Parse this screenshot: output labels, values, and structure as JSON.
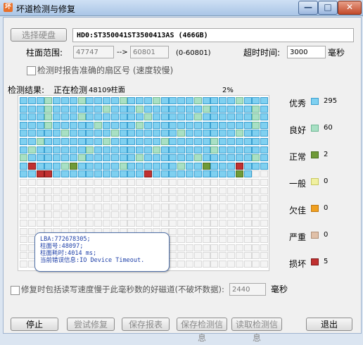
{
  "window": {
    "title": "坏道检测与修复",
    "icon_glyph": "坏",
    "min_glyph": "—",
    "max_glyph": "□",
    "close_glyph": "✕"
  },
  "disk": {
    "select_label": "选择硬盘",
    "info": "HD0:ST350041ST3500413AS (466GB)"
  },
  "range": {
    "label": "柱面范围:",
    "from": "47747",
    "arrow": "-->",
    "to": "60801",
    "hint": "(0-60801)"
  },
  "timeout": {
    "label": "超时时间:",
    "value": "3000",
    "unit": "毫秒"
  },
  "accurate_option": {
    "label": "检测时报告准确的扇区号 (速度较慢)",
    "checked": false
  },
  "result": {
    "label": "检测结果:",
    "status": "正在检测",
    "cylinder": "48109柱面",
    "progress": "2%"
  },
  "tooltip": {
    "lines": [
      "LBA:772678305;",
      "柱面号:48097;",
      "柱面耗时:4014 ms;",
      "当前错误信息:IO Device Timeout."
    ]
  },
  "legend": [
    {
      "name": "优秀",
      "count": "295",
      "color": "#7fd0f0",
      "border": "#3a9fd0",
      "key": "excellent"
    },
    {
      "name": "良好",
      "count": "60",
      "color": "#a8e0c4",
      "border": "#6fb895",
      "key": "good"
    },
    {
      "name": "正常",
      "count": "2",
      "color": "#6f9a38",
      "border": "#4a7020",
      "key": "normal"
    },
    {
      "name": "一般",
      "count": "0",
      "color": "#f0f0a0",
      "border": "#c8c860",
      "key": "fair"
    },
    {
      "name": "欠佳",
      "count": "0",
      "color": "#f0a020",
      "border": "#c07810",
      "key": "poor"
    },
    {
      "name": "严重",
      "count": "0",
      "color": "#e0c0a8",
      "border": "#b09078",
      "key": "severe"
    },
    {
      "name": "损坏",
      "count": "5",
      "color": "#c03030",
      "border": "#801818",
      "key": "damaged"
    }
  ],
  "colors": {
    "empty": "#f4f4f4",
    "empty_border": "#d8d8d8"
  },
  "repair_option": {
    "label": "修复时包括读写速度慢于此毫秒数的好磁道(不破坏数据):",
    "value": "2440",
    "unit": "毫秒",
    "checked": false
  },
  "buttons": {
    "stop": "停止",
    "try_repair": "尝试修复",
    "save_report": "保存报表",
    "save_info": "保存检测信息",
    "load_info": "读取检测信息",
    "exit": "退出"
  }
}
